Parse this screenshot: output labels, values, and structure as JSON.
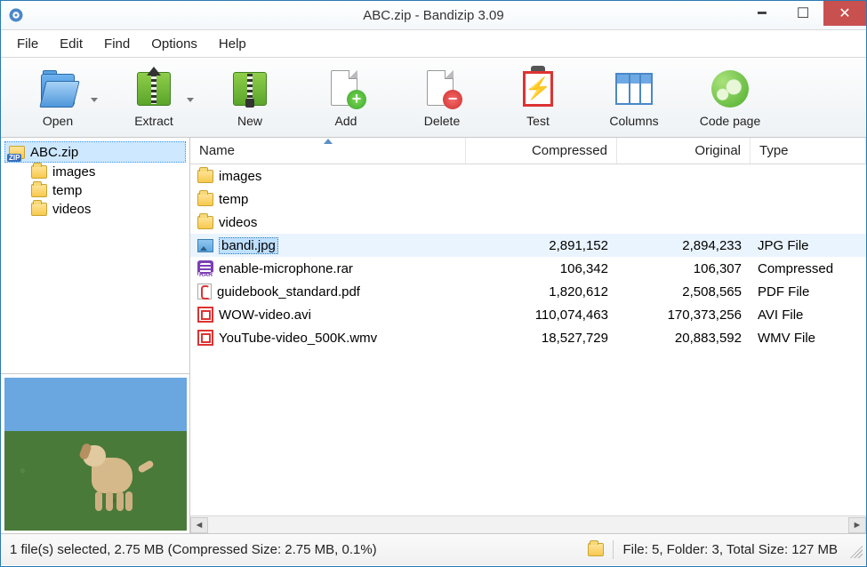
{
  "title": "ABC.zip - Bandizip 3.09",
  "menu": {
    "file": "File",
    "edit": "Edit",
    "find": "Find",
    "options": "Options",
    "help": "Help"
  },
  "toolbar": {
    "open": "Open",
    "extract": "Extract",
    "new": "New",
    "add": "Add",
    "delete": "Delete",
    "test": "Test",
    "columns": "Columns",
    "codepage": "Code page"
  },
  "tree": {
    "root": "ABC.zip",
    "children": [
      "images",
      "temp",
      "videos"
    ]
  },
  "columns": {
    "name": "Name",
    "compressed": "Compressed",
    "original": "Original",
    "type": "Type"
  },
  "rows": [
    {
      "icon": "folder",
      "name": "images",
      "compressed": "",
      "original": "",
      "type": ""
    },
    {
      "icon": "folder",
      "name": "temp",
      "compressed": "",
      "original": "",
      "type": ""
    },
    {
      "icon": "folder",
      "name": "videos",
      "compressed": "",
      "original": "",
      "type": ""
    },
    {
      "icon": "img",
      "name": "bandi.jpg",
      "compressed": "2,891,152",
      "original": "2,894,233",
      "type": "JPG File",
      "selected": true
    },
    {
      "icon": "rar",
      "name": "enable-microphone.rar",
      "compressed": "106,342",
      "original": "106,307",
      "type": "Compressed"
    },
    {
      "icon": "pdf",
      "name": "guidebook_standard.pdf",
      "compressed": "1,820,612",
      "original": "2,508,565",
      "type": "PDF File"
    },
    {
      "icon": "vid",
      "name": "WOW-video.avi",
      "compressed": "110,074,463",
      "original": "170,373,256",
      "type": "AVI File"
    },
    {
      "icon": "vid",
      "name": "YouTube-video_500K.wmv",
      "compressed": "18,527,729",
      "original": "20,883,592",
      "type": "WMV File"
    }
  ],
  "status": {
    "left": "1 file(s) selected, 2.75 MB (Compressed Size: 2.75 MB, 0.1%)",
    "right": "File: 5, Folder: 3, Total Size: 127 MB"
  }
}
